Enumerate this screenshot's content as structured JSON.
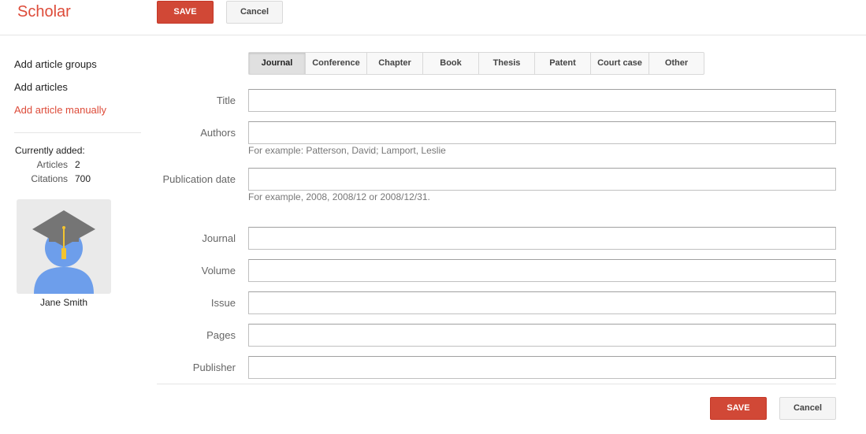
{
  "header": {
    "logo": "Scholar",
    "save_label": "SAVE",
    "cancel_label": "Cancel"
  },
  "sidebar": {
    "links": [
      {
        "label": "Add article groups"
      },
      {
        "label": "Add articles"
      },
      {
        "label": "Add article manually"
      }
    ],
    "currently_added_title": "Currently added:",
    "stats": [
      {
        "label": "Articles",
        "value": "2"
      },
      {
        "label": "Citations",
        "value": "700"
      }
    ],
    "user_name": "Jane Smith"
  },
  "tabs": [
    {
      "label": "Journal"
    },
    {
      "label": "Conference"
    },
    {
      "label": "Chapter"
    },
    {
      "label": "Book"
    },
    {
      "label": "Thesis"
    },
    {
      "label": "Patent"
    },
    {
      "label": "Court case"
    },
    {
      "label": "Other"
    }
  ],
  "form": {
    "title": {
      "label": "Title",
      "value": ""
    },
    "authors": {
      "label": "Authors",
      "value": "",
      "hint": "For example: Patterson, David; Lamport, Leslie"
    },
    "publication_date": {
      "label": "Publication date",
      "value": "",
      "hint": "For example, 2008, 2008/12 or 2008/12/31."
    },
    "journal": {
      "label": "Journal",
      "value": ""
    },
    "volume": {
      "label": "Volume",
      "value": ""
    },
    "issue": {
      "label": "Issue",
      "value": ""
    },
    "pages": {
      "label": "Pages",
      "value": ""
    },
    "publisher": {
      "label": "Publisher",
      "value": ""
    }
  },
  "footer": {
    "save_label": "SAVE",
    "cancel_label": "Cancel"
  },
  "colors": {
    "brand": "#dd4b39",
    "save_button": "#d14836",
    "avatar_body": "#6d9eeb",
    "cap": "#757575",
    "tassel": "#f4c430"
  },
  "icons": {
    "avatar": "graduate-avatar-icon"
  }
}
